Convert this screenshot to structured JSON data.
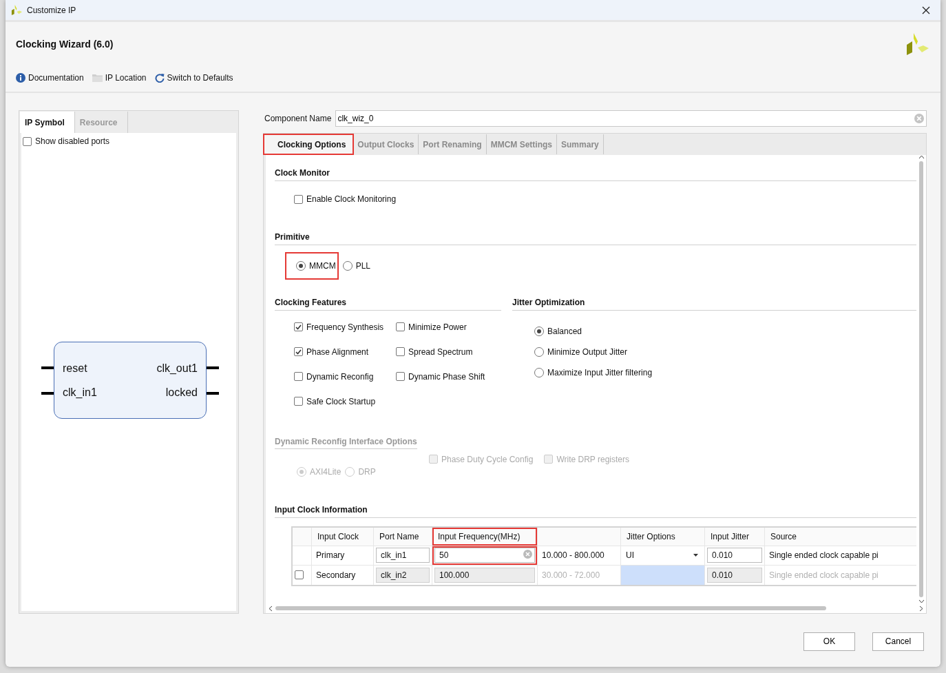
{
  "window": {
    "title": "Customize IP"
  },
  "header": {
    "title": "Clocking Wizard (6.0)",
    "toolbar": [
      {
        "label": "Documentation",
        "kind": "info"
      },
      {
        "label": "IP Location",
        "kind": "folder"
      },
      {
        "label": "Switch to Defaults",
        "kind": "refresh"
      }
    ]
  },
  "left_panel": {
    "tabs": [
      {
        "label": "IP Symbol",
        "selected": true
      },
      {
        "label": "Resource",
        "selected": false
      }
    ],
    "show_disabled_ports": {
      "label": "Show disabled ports",
      "checked": false
    },
    "symbol": {
      "inputs": [
        "reset",
        "clk_in1"
      ],
      "outputs": [
        "clk_out1",
        "locked"
      ]
    }
  },
  "component_name": {
    "label": "Component Name",
    "value": "clk_wiz_0"
  },
  "tabs": [
    {
      "label": "Clocking Options",
      "selected": true,
      "highlighted": true
    },
    {
      "label": "Output Clocks",
      "selected": false,
      "highlighted": false
    },
    {
      "label": "Port Renaming",
      "selected": false,
      "highlighted": false
    },
    {
      "label": "MMCM Settings",
      "selected": false,
      "highlighted": false
    },
    {
      "label": "Summary",
      "selected": false,
      "highlighted": false
    }
  ],
  "clock_monitor": {
    "title": "Clock Monitor",
    "options": [
      {
        "label": "Enable Clock Monitoring",
        "checked": false
      }
    ]
  },
  "primitive": {
    "title": "Primitive",
    "options": [
      {
        "label": "MMCM",
        "selected": true,
        "highlighted": true
      },
      {
        "label": "PLL",
        "selected": false,
        "highlighted": false
      }
    ]
  },
  "clocking_features": {
    "title": "Clocking Features",
    "options": [
      {
        "label": "Frequency Synthesis",
        "checked": true
      },
      {
        "label": "Minimize Power",
        "checked": false
      },
      {
        "label": "Phase Alignment",
        "checked": true
      },
      {
        "label": "Spread Spectrum",
        "checked": false
      },
      {
        "label": "Dynamic Reconfig",
        "checked": false
      },
      {
        "label": "Dynamic Phase Shift",
        "checked": false
      },
      {
        "label": "Safe Clock Startup",
        "checked": false
      }
    ]
  },
  "jitter_optimization": {
    "title": "Jitter Optimization",
    "options": [
      {
        "label": "Balanced",
        "selected": true
      },
      {
        "label": "Minimize Output Jitter",
        "selected": false
      },
      {
        "label": "Maximize Input Jitter filtering",
        "selected": false
      }
    ]
  },
  "dynamic_reconfig": {
    "title": "Dynamic Reconfig Interface Options",
    "disabled": true,
    "interface": [
      {
        "label": "AXI4Lite",
        "selected": true
      },
      {
        "label": "DRP",
        "selected": false
      }
    ],
    "options": [
      {
        "label": "Phase Duty Cycle Config",
        "checked": false
      },
      {
        "label": "Write DRP registers",
        "checked": false
      }
    ]
  },
  "input_clock_information": {
    "title": "Input Clock Information",
    "columns": [
      {
        "kind": "check",
        "highlighted": false
      },
      {
        "kind": "text",
        "label": "Input Clock",
        "highlighted": false
      },
      {
        "kind": "text",
        "label": "Port Name",
        "highlighted": false
      },
      {
        "kind": "text",
        "label": "Input Frequency(MHz)",
        "highlighted": true
      },
      {
        "kind": "text",
        "highlighted": false
      },
      {
        "kind": "text",
        "label": "Jitter Options",
        "highlighted": false
      },
      {
        "kind": "text",
        "label": "Input Jitter",
        "highlighted": false
      },
      {
        "kind": "text",
        "label": "Source",
        "highlighted": false
      }
    ],
    "rows": [
      {
        "kind": "primary",
        "enabled": true,
        "input_clock": "Primary",
        "port_name": "clk_in1",
        "frequency": "50",
        "range": "10.000 - 800.000",
        "jitter_options": "UI",
        "input_jitter": "0.010",
        "source": "Single ended clock capable pi"
      },
      {
        "kind": "secondary",
        "enabled": false,
        "checked": false,
        "input_clock": "Secondary",
        "port_name": "clk_in2",
        "frequency": "100.000",
        "range": "30.000 - 72.000",
        "input_jitter": "0.010",
        "source": "Single ended clock capable pi"
      }
    ]
  },
  "buttons": [
    {
      "label": "OK"
    },
    {
      "label": "Cancel"
    }
  ]
}
